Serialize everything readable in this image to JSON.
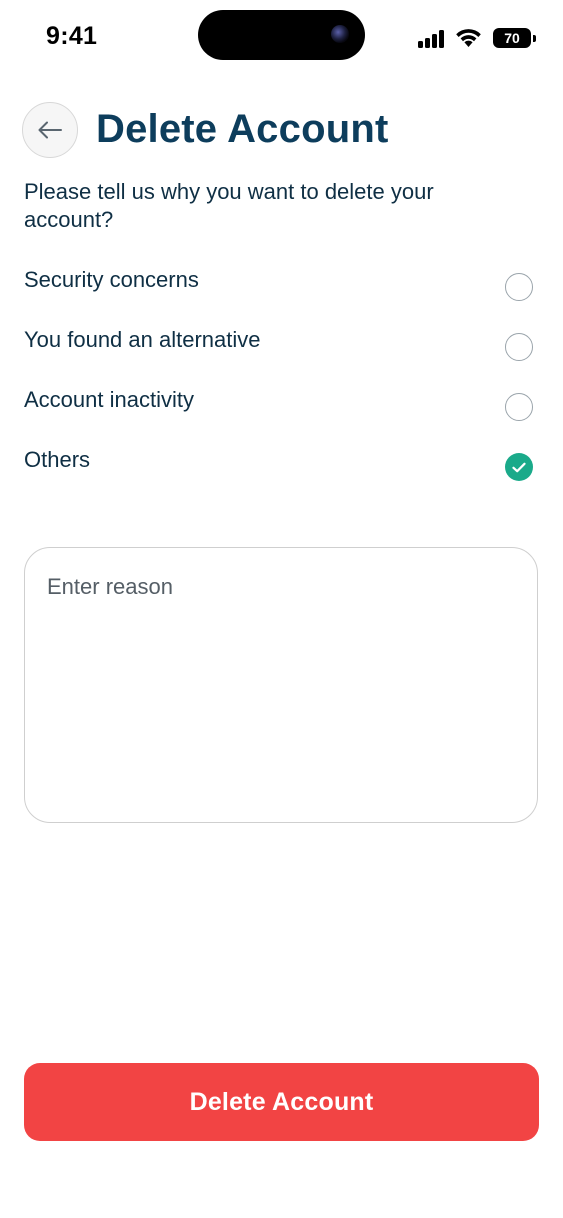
{
  "status_bar": {
    "time": "9:41",
    "battery_level": "70",
    "icons": [
      "signal-icon",
      "wifi-icon",
      "battery-icon"
    ]
  },
  "header": {
    "back_icon": "arrow-left-icon",
    "title": "Delete Account"
  },
  "question": "Please tell us why you want to delete your account?",
  "options": [
    {
      "label": "Security concerns",
      "selected": false
    },
    {
      "label": "You found an alternative",
      "selected": false
    },
    {
      "label": "Account inactivity",
      "selected": false
    },
    {
      "label": "Others",
      "selected": true
    }
  ],
  "reason": {
    "placeholder": "Enter reason",
    "value": ""
  },
  "delete_button": {
    "label": "Delete Account"
  },
  "colors": {
    "title": "#0d3d5c",
    "text": "#0f2f44",
    "accent_selected": "#1aaa8a",
    "danger": "#f24444",
    "border": "#cfcfcf"
  }
}
